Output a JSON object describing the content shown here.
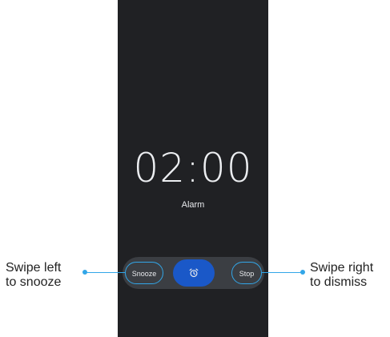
{
  "alarm_screen": {
    "time": "02:00",
    "label": "Alarm",
    "snooze_label": "Snooze",
    "stop_label": "Stop",
    "handle_icon": "alarm-clock-icon"
  },
  "annotations": {
    "left_line1": "Swipe left",
    "left_line2": "to snooze",
    "right_line1": "Swipe right",
    "right_line2": "to dismiss"
  },
  "colors": {
    "screen_bg": "#202124",
    "slider_track": "#3b3e43",
    "handle": "#1a58c8",
    "highlight": "#32a6e8"
  }
}
